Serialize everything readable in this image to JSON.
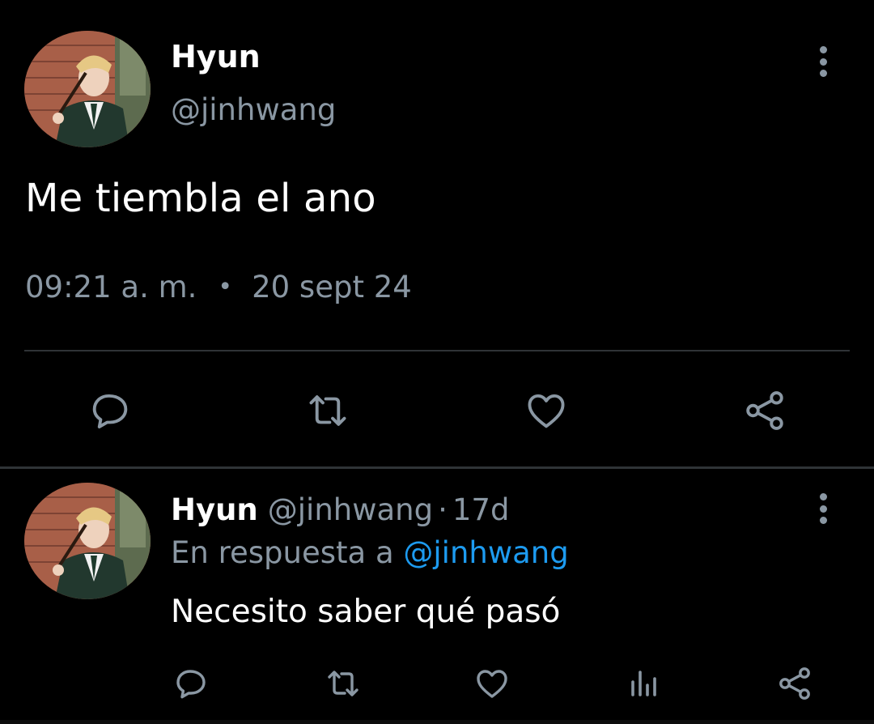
{
  "main_tweet": {
    "author_name": "Hyun",
    "handle": "@jinhwang",
    "text": "Me tiembla el ano",
    "time": "09:21 a. m.",
    "separator": "•",
    "date": "20 sept 24",
    "actions": [
      {
        "name": "reply",
        "icon": "reply-icon"
      },
      {
        "name": "retweet",
        "icon": "retweet-icon"
      },
      {
        "name": "like",
        "icon": "heart-icon"
      },
      {
        "name": "share",
        "icon": "share-icon"
      }
    ]
  },
  "reply_tweet": {
    "author_name": "Hyun",
    "handle": "@jinhwang",
    "dot": "·",
    "time_ago": "17d",
    "replying_prefix": "En respuesta a",
    "replying_to": "@jinhwang",
    "text": "Necesito saber qué pasó",
    "actions": [
      {
        "name": "reply",
        "icon": "reply-icon"
      },
      {
        "name": "retweet",
        "icon": "retweet-icon"
      },
      {
        "name": "like",
        "icon": "heart-icon"
      },
      {
        "name": "views",
        "icon": "analytics-icon"
      },
      {
        "name": "share",
        "icon": "share-icon"
      }
    ]
  },
  "colors": {
    "background": "#000000",
    "text_primary": "#ffffff",
    "text_secondary": "#8a97a3",
    "link": "#1d9bf0",
    "divider": "#2f3336"
  }
}
